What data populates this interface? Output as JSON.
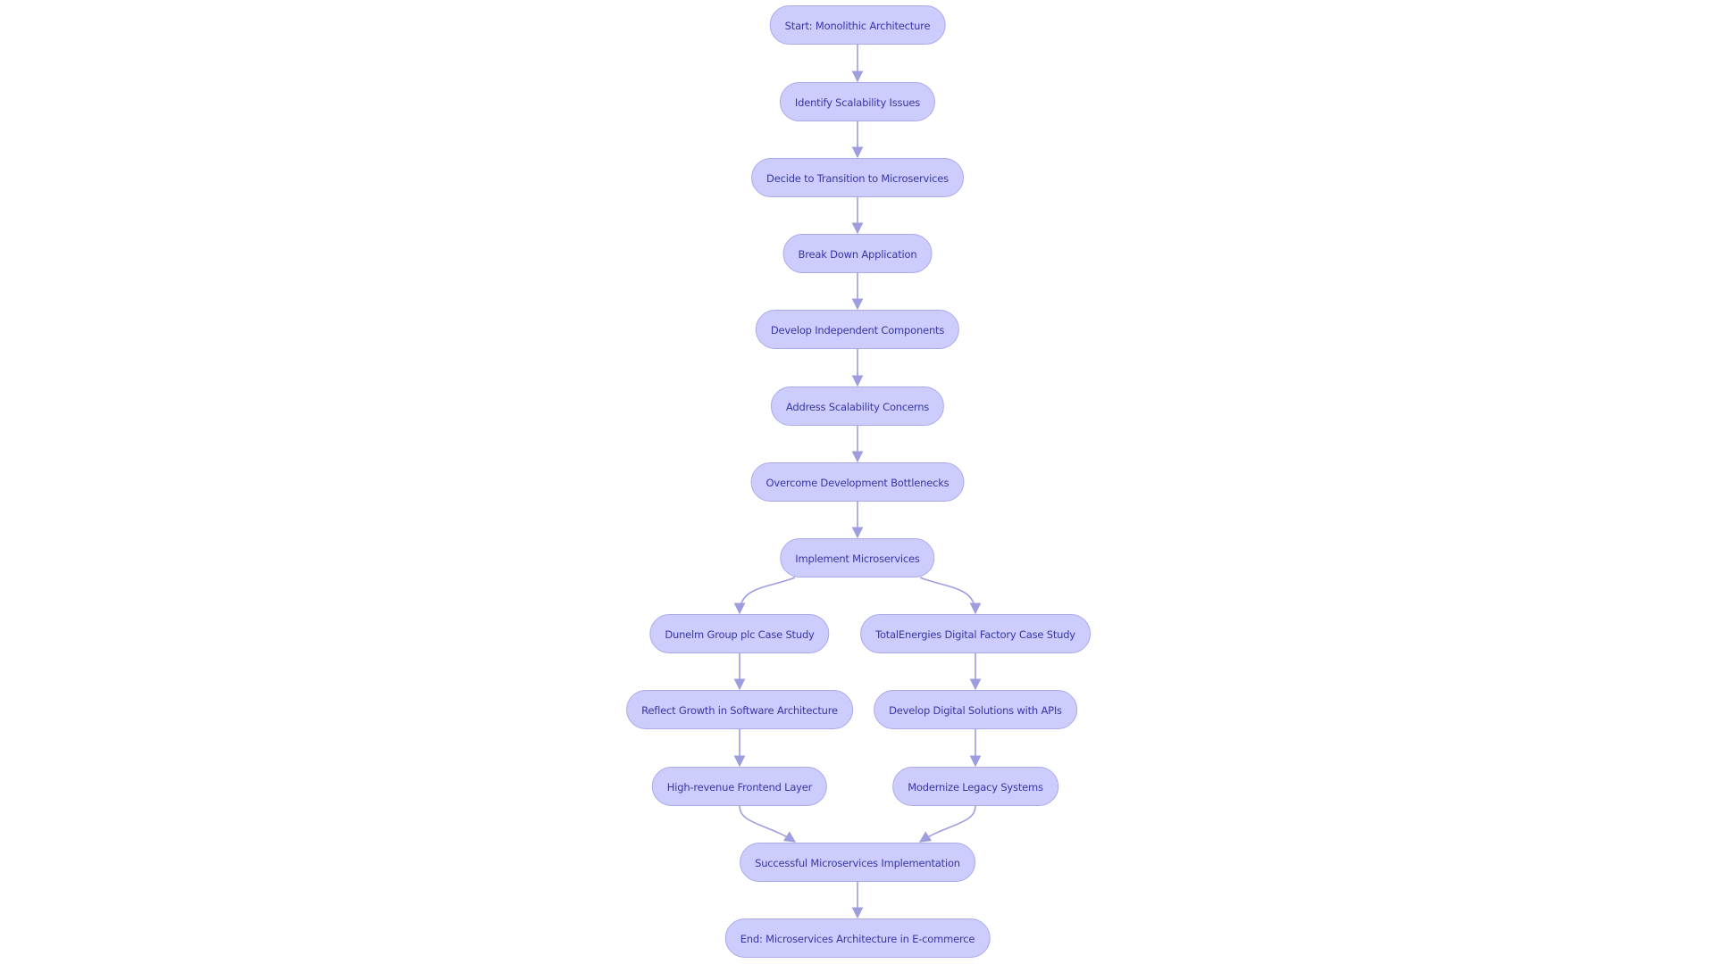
{
  "colors": {
    "node_fill": "#cdcdfd",
    "node_stroke": "#a9a9ec",
    "text": "#3636a6",
    "edge": "#9d9de0"
  },
  "nodes": [
    {
      "id": "start",
      "label": "Start: Monolithic Architecture"
    },
    {
      "id": "identify",
      "label": "Identify Scalability Issues"
    },
    {
      "id": "decide",
      "label": "Decide to Transition to Microservices"
    },
    {
      "id": "breakdown",
      "label": "Break Down Application"
    },
    {
      "id": "develop",
      "label": "Develop Independent Components"
    },
    {
      "id": "address",
      "label": "Address Scalability Concerns"
    },
    {
      "id": "overcome",
      "label": "Overcome Development Bottlenecks"
    },
    {
      "id": "implement",
      "label": "Implement Microservices"
    },
    {
      "id": "dunelm",
      "label": "Dunelm Group plc Case Study"
    },
    {
      "id": "total",
      "label": "TotalEnergies Digital Factory Case Study"
    },
    {
      "id": "reflect",
      "label": "Reflect Growth in Software Architecture"
    },
    {
      "id": "apis",
      "label": "Develop Digital Solutions with APIs"
    },
    {
      "id": "frontend",
      "label": "High-revenue Frontend Layer"
    },
    {
      "id": "legacy",
      "label": "Modernize Legacy Systems"
    },
    {
      "id": "success",
      "label": "Successful Microservices Implementation"
    },
    {
      "id": "end",
      "label": "End: Microservices Architecture in E-commerce"
    }
  ],
  "edges": [
    [
      "start",
      "identify"
    ],
    [
      "identify",
      "decide"
    ],
    [
      "decide",
      "breakdown"
    ],
    [
      "breakdown",
      "develop"
    ],
    [
      "develop",
      "address"
    ],
    [
      "address",
      "overcome"
    ],
    [
      "overcome",
      "implement"
    ],
    [
      "implement",
      "dunelm"
    ],
    [
      "implement",
      "total"
    ],
    [
      "dunelm",
      "reflect"
    ],
    [
      "reflect",
      "frontend"
    ],
    [
      "total",
      "apis"
    ],
    [
      "apis",
      "legacy"
    ],
    [
      "frontend",
      "success"
    ],
    [
      "legacy",
      "success"
    ],
    [
      "success",
      "end"
    ]
  ]
}
